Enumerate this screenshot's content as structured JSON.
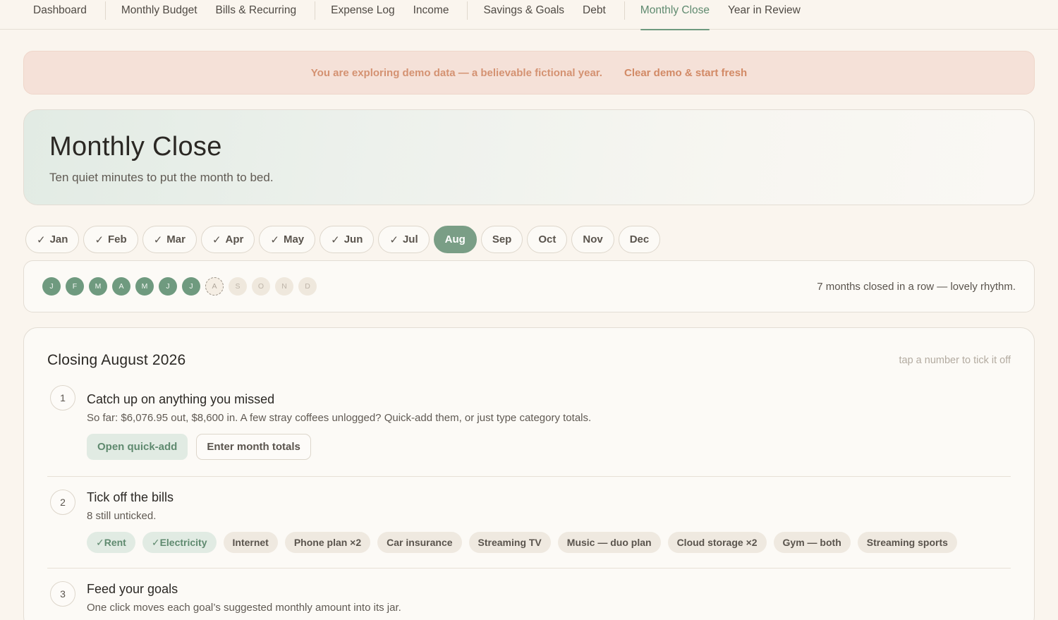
{
  "nav": {
    "items": [
      {
        "label": "Dashboard"
      },
      {
        "label": "Monthly Budget"
      },
      {
        "label": "Bills & Recurring"
      },
      {
        "label": "Expense Log"
      },
      {
        "label": "Income"
      },
      {
        "label": "Savings & Goals"
      },
      {
        "label": "Debt"
      },
      {
        "label": "Monthly Close",
        "active": true
      },
      {
        "label": "Year in Review"
      }
    ]
  },
  "banner": {
    "message": "You are exploring demo data — a believable fictional year.",
    "action": "Clear demo & start fresh"
  },
  "hero": {
    "title": "Monthly Close",
    "subtitle": "Ten quiet minutes to put the month to bed."
  },
  "months": {
    "check_glyph": "✓",
    "pills": [
      {
        "label": "Jan",
        "closed": true
      },
      {
        "label": "Feb",
        "closed": true
      },
      {
        "label": "Mar",
        "closed": true
      },
      {
        "label": "Apr",
        "closed": true
      },
      {
        "label": "May",
        "closed": true
      },
      {
        "label": "Jun",
        "closed": true
      },
      {
        "label": "Jul",
        "closed": true
      },
      {
        "label": "Aug",
        "current": true
      },
      {
        "label": "Sep"
      },
      {
        "label": "Oct"
      },
      {
        "label": "Nov"
      },
      {
        "label": "Dec"
      }
    ]
  },
  "streak": {
    "dots": [
      {
        "letter": "J",
        "state": "closed"
      },
      {
        "letter": "F",
        "state": "closed"
      },
      {
        "letter": "M",
        "state": "closed"
      },
      {
        "letter": "A",
        "state": "closed"
      },
      {
        "letter": "M",
        "state": "closed"
      },
      {
        "letter": "J",
        "state": "closed"
      },
      {
        "letter": "J",
        "state": "closed"
      },
      {
        "letter": "A",
        "state": "current"
      },
      {
        "letter": "S",
        "state": "future"
      },
      {
        "letter": "O",
        "state": "future"
      },
      {
        "letter": "N",
        "state": "future"
      },
      {
        "letter": "D",
        "state": "future"
      }
    ],
    "message": "7 months closed in a row — lovely rhythm."
  },
  "close": {
    "title": "Closing August 2026",
    "hint": "tap a number to tick it off",
    "steps": [
      {
        "number": "1",
        "title": "Catch up on anything you missed",
        "description": "So far: $6,076.95 out, $8,600 in. A few stray coffees unlogged? Quick-add them, or just type category totals.",
        "buttons": [
          "Open quick-add",
          "Enter month totals"
        ]
      },
      {
        "number": "2",
        "title": "Tick off the bills",
        "description": "8 still unticked.",
        "bills": [
          {
            "label": "✓Rent",
            "paid": true
          },
          {
            "label": "✓Electricity",
            "paid": true
          },
          {
            "label": "Internet"
          },
          {
            "label": "Phone plan ×2"
          },
          {
            "label": "Car insurance"
          },
          {
            "label": "Streaming TV"
          },
          {
            "label": "Music — duo plan"
          },
          {
            "label": "Cloud storage ×2"
          },
          {
            "label": "Gym — both"
          },
          {
            "label": "Streaming sports"
          }
        ]
      },
      {
        "number": "3",
        "title": "Feed your goals",
        "description": "One click moves each goal’s suggested monthly amount into its jar."
      }
    ]
  },
  "colors": {
    "accent": "#7a9e86",
    "accent_text": "#5f8a6f",
    "banner_bg": "#f5e1d8",
    "banner_text": "#d49272",
    "page_bg": "#faf5ee"
  }
}
